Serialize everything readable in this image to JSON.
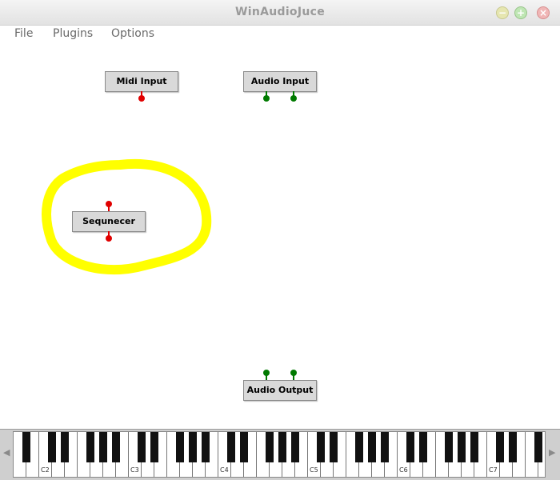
{
  "window": {
    "title": "WinAudioJuce"
  },
  "window_controls": {
    "minimize": "−",
    "maximize": "+",
    "close": "×"
  },
  "menu": {
    "items": [
      "File",
      "Plugins",
      "Options"
    ]
  },
  "nodes": {
    "midi_input": "Midi Input",
    "audio_input": "Audio Input",
    "sequencer": "Sequnecer",
    "audio_output": "Audio Output"
  },
  "pin_colors": {
    "midi": "#e00000",
    "audio": "#007a00"
  },
  "annotation": {
    "color": "#ffff00"
  },
  "keyboard": {
    "left_arrow": "◀",
    "right_arrow": "▶",
    "octave_labels": [
      "C2",
      "C3",
      "C4",
      "C5",
      "C6",
      "C7"
    ]
  }
}
